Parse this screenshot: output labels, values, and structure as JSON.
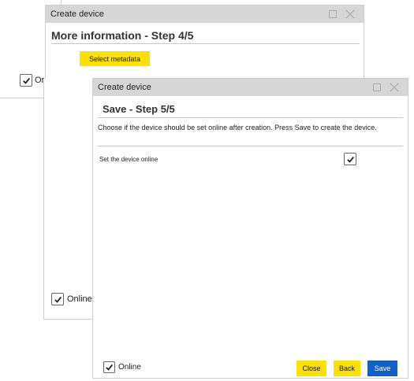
{
  "step4": {
    "window_title": "Create device",
    "heading": "More information - Step 4/5",
    "metadata_button": "Select metadata"
  },
  "back_window": {
    "online_label": "Or"
  },
  "mid_panel": {
    "online_label": "Online"
  },
  "step5": {
    "window_title": "Create device",
    "heading": "Save - Step 5/5",
    "description": "Choose if the device should be set online after creation. Press Save to create the device.",
    "online_setting_label": "Set the device online",
    "online_setting_checked": true,
    "footer_online_label": "Online",
    "close_button": "Close",
    "back_button": "Back",
    "save_button": "Save"
  },
  "colors": {
    "titlebar": "#d6d6d6",
    "yellow_button": "#ffe100",
    "blue_button": "#1060c8"
  }
}
